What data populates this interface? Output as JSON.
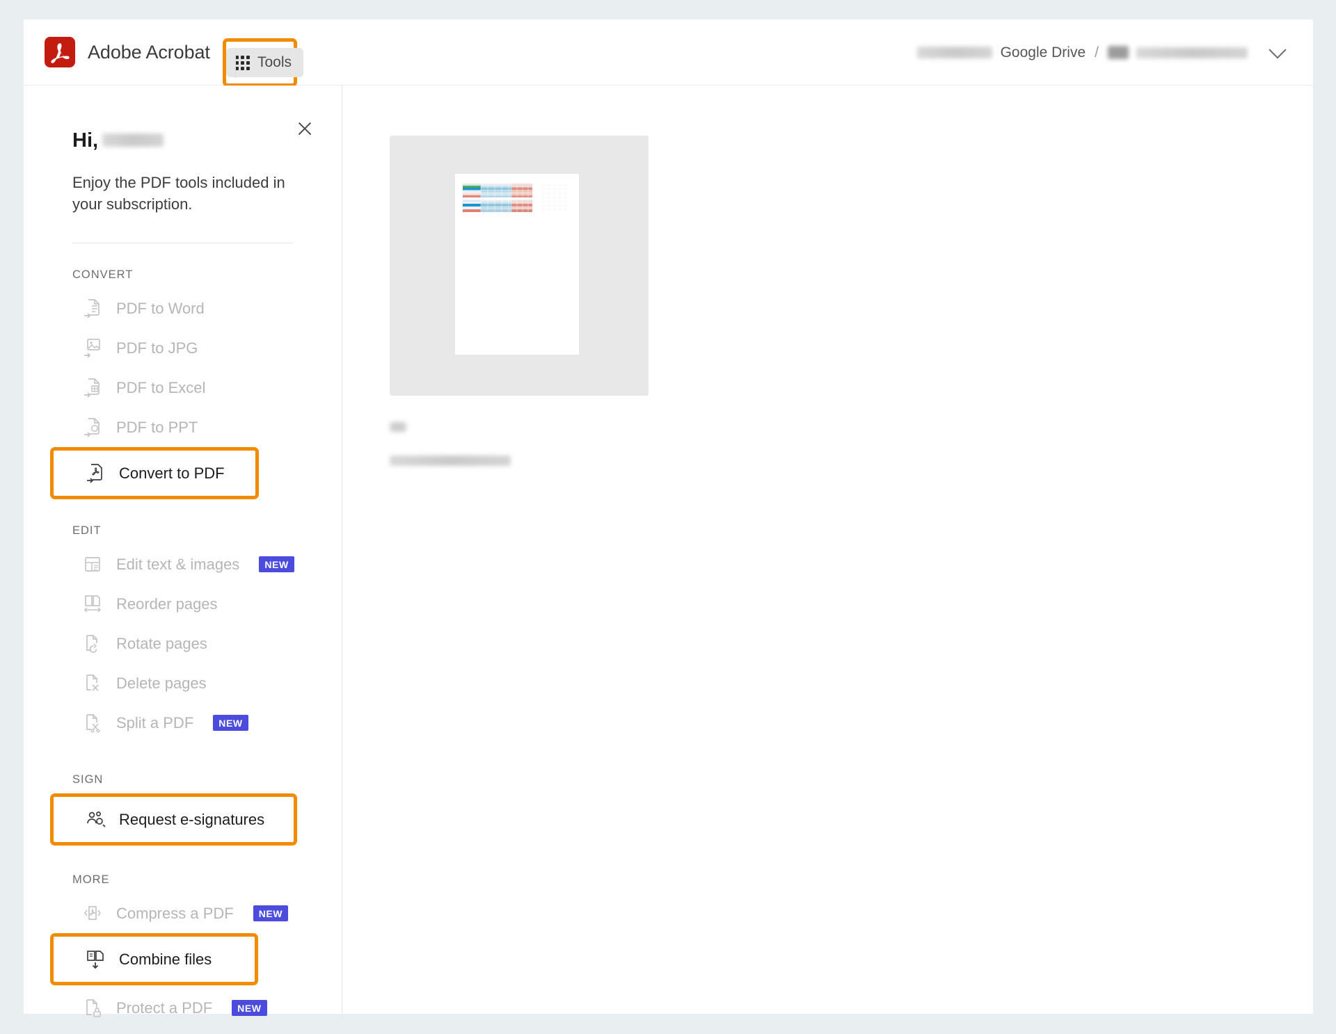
{
  "app": {
    "brand_name": "Adobe Acrobat",
    "logo_icon": "adobe-acrobat-logo",
    "accent_highlight_color": "#f28b00",
    "badge_color": "#4b4bdd",
    "brand_red": "#c41b10"
  },
  "header": {
    "tools_button": {
      "label": "Tools",
      "icon": "grid-dots-icon",
      "highlighted": true
    },
    "breadcrumb": {
      "user_name": "[redacted]",
      "storage_label": "Google Drive",
      "separator": "/",
      "file_name": "[redacted]",
      "chevron_icon": "chevron-down-icon"
    }
  },
  "sidebar": {
    "close_icon": "close-icon",
    "greeting_prefix": "Hi,",
    "greeting_name": "[redacted]",
    "subtitle": "Enjoy the PDF tools included in your subscription.",
    "sections": [
      {
        "title": "CONVERT",
        "items": [
          {
            "label": "PDF to Word",
            "icon": "pdf-to-word-icon",
            "enabled": false,
            "badge": "",
            "highlighted": false
          },
          {
            "label": "PDF to JPG",
            "icon": "pdf-to-jpg-icon",
            "enabled": false,
            "badge": "",
            "highlighted": false
          },
          {
            "label": "PDF to Excel",
            "icon": "pdf-to-excel-icon",
            "enabled": false,
            "badge": "",
            "highlighted": false
          },
          {
            "label": "PDF to PPT",
            "icon": "pdf-to-ppt-icon",
            "enabled": false,
            "badge": "",
            "highlighted": false
          },
          {
            "label": "Convert to PDF",
            "icon": "convert-to-pdf-icon",
            "enabled": true,
            "badge": "",
            "highlighted": true
          }
        ]
      },
      {
        "title": "EDIT",
        "items": [
          {
            "label": "Edit text & images",
            "icon": "edit-text-images-icon",
            "enabled": false,
            "badge": "NEW",
            "highlighted": false
          },
          {
            "label": "Reorder pages",
            "icon": "reorder-pages-icon",
            "enabled": false,
            "badge": "",
            "highlighted": false
          },
          {
            "label": "Rotate pages",
            "icon": "rotate-pages-icon",
            "enabled": false,
            "badge": "",
            "highlighted": false
          },
          {
            "label": "Delete pages",
            "icon": "delete-pages-icon",
            "enabled": false,
            "badge": "",
            "highlighted": false
          },
          {
            "label": "Split a PDF",
            "icon": "split-pdf-icon",
            "enabled": false,
            "badge": "NEW",
            "highlighted": false
          }
        ]
      },
      {
        "title": "SIGN",
        "items": [
          {
            "label": "Request e-signatures",
            "icon": "request-esignatures-icon",
            "enabled": true,
            "badge": "",
            "highlighted": true
          }
        ]
      },
      {
        "title": "MORE",
        "items": [
          {
            "label": "Compress a PDF",
            "icon": "compress-pdf-icon",
            "enabled": false,
            "badge": "NEW",
            "highlighted": false
          },
          {
            "label": "Combine files",
            "icon": "combine-files-icon",
            "enabled": true,
            "badge": "",
            "highlighted": true
          },
          {
            "label": "Protect a PDF",
            "icon": "protect-pdf-icon",
            "enabled": false,
            "badge": "NEW",
            "highlighted": false
          }
        ]
      }
    ]
  },
  "main": {
    "thumbnail": {
      "alt": "pdf-page-thumbnail",
      "content_description": "spreadsheet table with teal and salmon colored rows at top of page"
    },
    "file_badge": "[redacted]",
    "file_title": "[redacted]"
  }
}
